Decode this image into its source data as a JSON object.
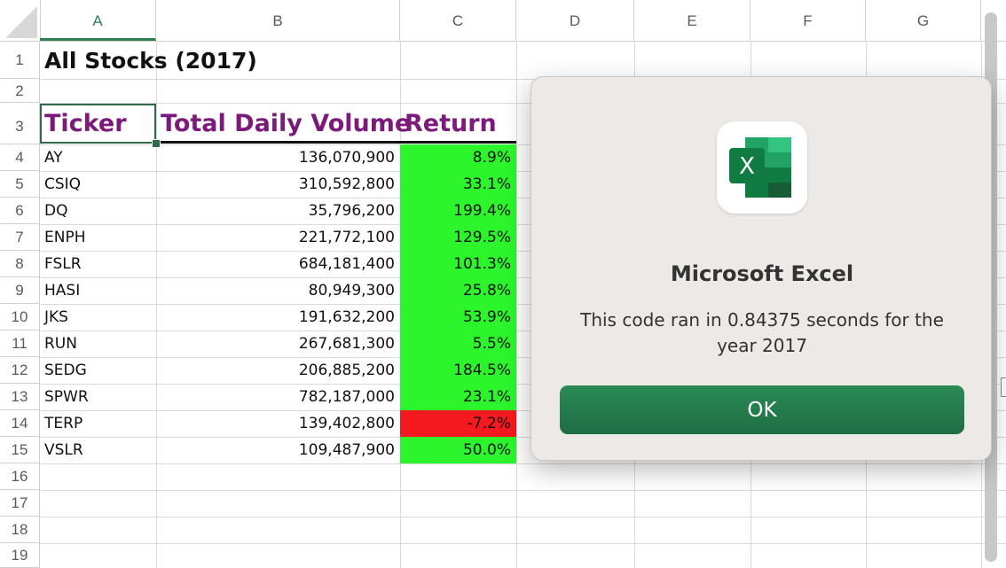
{
  "columns": [
    "A",
    "B",
    "C",
    "D",
    "E",
    "F",
    "G"
  ],
  "rows": [
    "1",
    "2",
    "3",
    "4",
    "5",
    "6",
    "7",
    "8",
    "9",
    "10",
    "11",
    "12",
    "13",
    "14",
    "15",
    "16",
    "17",
    "18",
    "19"
  ],
  "sheet": {
    "title": "All Stocks (2017)",
    "headers": {
      "ticker": "Ticker",
      "volume": "Total Daily Volume",
      "return": "Return"
    },
    "data": [
      {
        "ticker": "AY",
        "volume": "136,070,900",
        "return": "8.9%",
        "positive": true
      },
      {
        "ticker": "CSIQ",
        "volume": "310,592,800",
        "return": "33.1%",
        "positive": true
      },
      {
        "ticker": "DQ",
        "volume": "35,796,200",
        "return": "199.4%",
        "positive": true
      },
      {
        "ticker": "ENPH",
        "volume": "221,772,100",
        "return": "129.5%",
        "positive": true
      },
      {
        "ticker": "FSLR",
        "volume": "684,181,400",
        "return": "101.3%",
        "positive": true
      },
      {
        "ticker": "HASI",
        "volume": "80,949,300",
        "return": "25.8%",
        "positive": true
      },
      {
        "ticker": "JKS",
        "volume": "191,632,200",
        "return": "53.9%",
        "positive": true
      },
      {
        "ticker": "RUN",
        "volume": "267,681,300",
        "return": "5.5%",
        "positive": true
      },
      {
        "ticker": "SEDG",
        "volume": "206,885,200",
        "return": "184.5%",
        "positive": true
      },
      {
        "ticker": "SPWR",
        "volume": "782,187,000",
        "return": "23.1%",
        "positive": true
      },
      {
        "ticker": "TERP",
        "volume": "139,402,800",
        "return": "-7.2%",
        "positive": false
      },
      {
        "ticker": "VSLR",
        "volume": "109,487,900",
        "return": "50.0%",
        "positive": true
      }
    ]
  },
  "colors": {
    "positive_fill": "#2cf52c",
    "negative_fill": "#f4191f",
    "header_text": "#7b1a7b",
    "excel_green": "#1e6e43"
  },
  "dialog": {
    "icon": "excel-app-icon",
    "icon_letter": "X",
    "title": "Microsoft Excel",
    "message": "This code ran in 0.84375 seconds for the year 2017",
    "ok_label": "OK"
  }
}
